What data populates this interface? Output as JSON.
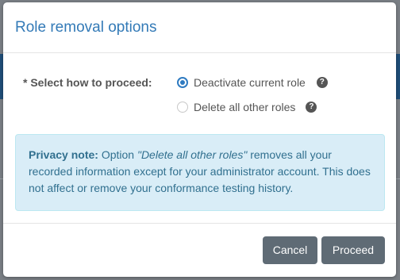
{
  "dialog": {
    "title": "Role removal options",
    "field_label": "* Select how to proceed:",
    "options": [
      {
        "label": "Deactivate current role",
        "selected": true,
        "help_icon": "question-circle-icon"
      },
      {
        "label": "Delete all other roles",
        "selected": false,
        "help_icon": "question-circle-icon"
      }
    ],
    "help_glyph": "?",
    "privacy_note": {
      "heading": "Privacy note:",
      "text_before": " Option ",
      "option_name": "\"Delete all other roles\"",
      "text_after": " removes all your recorded information except for your administrator account. This does not affect or remove your conformance testing history."
    },
    "buttons": {
      "cancel": "Cancel",
      "proceed": "Proceed"
    }
  },
  "colors": {
    "title": "#337ab7",
    "radio_accent": "#2f7bc1",
    "alert_bg": "#d9edf7",
    "alert_text": "#31708f",
    "button_bg": "#5f6b75"
  }
}
